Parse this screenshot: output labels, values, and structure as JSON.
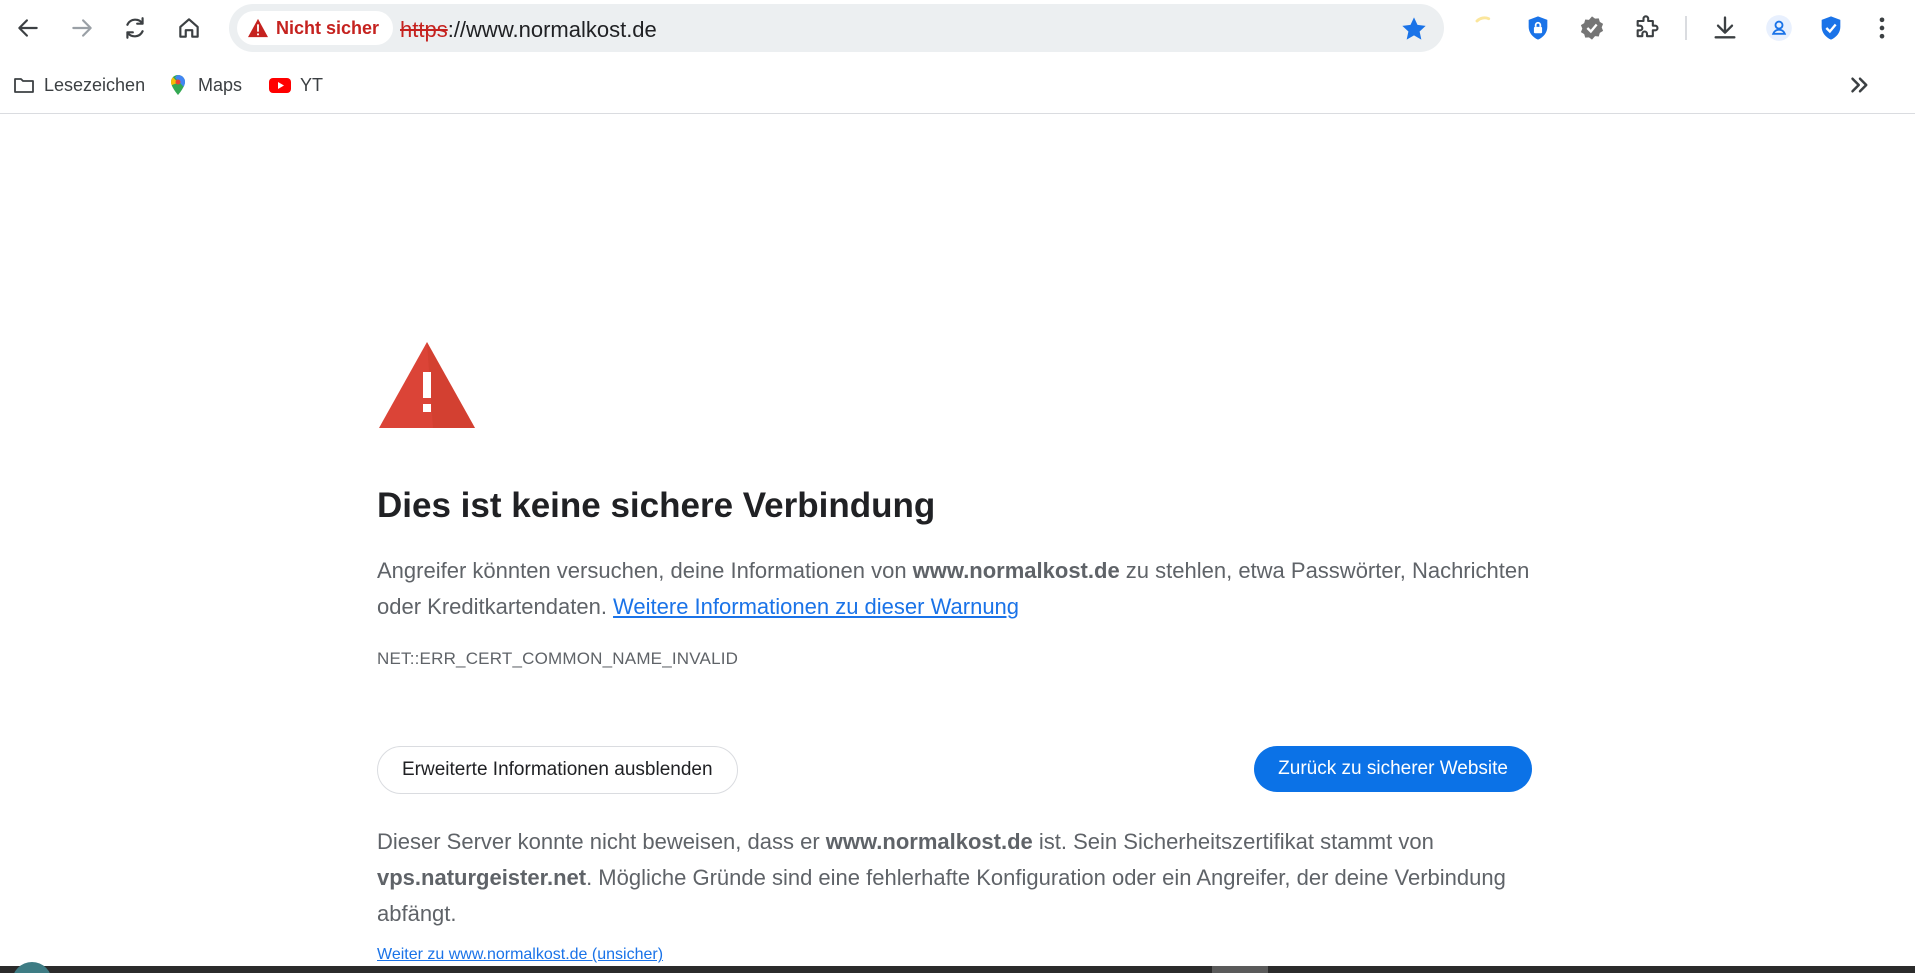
{
  "browser": {
    "security_chip": "Nicht sicher",
    "url_scheme": "https",
    "url_rest": "://www.normalkost.de",
    "accent": "#1a73e8",
    "danger": "#c5221f"
  },
  "bookmarks": [
    {
      "label": "Lesezeichen",
      "icon": "folder-icon"
    },
    {
      "label": "Maps",
      "icon": "maps-pin-icon"
    },
    {
      "label": "YT",
      "icon": "youtube-icon"
    }
  ],
  "interstitial": {
    "headline": "Dies ist keine sichere Verbindung",
    "explain_part1": "Angreifer könnten versuchen, deine Informationen von ",
    "explain_host": "www.normalkost.de",
    "explain_part2": " zu stehlen, etwa Passwörter, Nachrichten oder Kreditkartendaten. ",
    "learn_more": "Weitere Informationen zu dieser Warnung",
    "error_code": "NET::ERR_CERT_COMMON_NAME_INVALID",
    "details_button": "Erweiterte Informationen ausblenden",
    "back_button": "Zurück zu sicherer Website",
    "details_part1": "Dieser Server konnte nicht beweisen, dass er ",
    "details_host": "www.normalkost.de",
    "details_part2": " ist. Sein Sicherheitszertifikat stammt von ",
    "details_issuer": "vps.naturgeister.net",
    "details_part3": ". Mögliche Gründe sind eine fehlerhafte Konfiguration oder ein Angreifer, der deine Verbindung abfängt.",
    "proceed_link": "Weiter zu www.normalkost.de (unsicher)",
    "warning_color": "#db4437"
  }
}
